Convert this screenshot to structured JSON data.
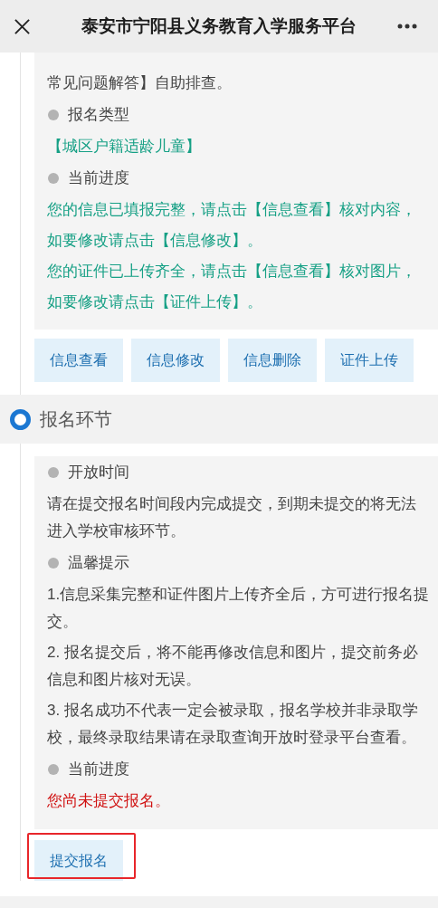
{
  "header": {
    "title": "泰安市宁阳县义务教育入学服务平台"
  },
  "sections": [
    {
      "items": [
        {
          "kind": "text",
          "text": "常见问题解答】自助排查。"
        },
        {
          "kind": "label",
          "text": "报名类型"
        },
        {
          "kind": "success",
          "text": "【城区户籍适龄儿童】"
        },
        {
          "kind": "label",
          "text": "当前进度"
        },
        {
          "kind": "success",
          "text": "您的信息已填报完整，请点击【信息查看】核对内容，"
        },
        {
          "kind": "success",
          "text": "如要修改请点击【信息修改】。"
        },
        {
          "kind": "success",
          "text": "您的证件已上传齐全，请点击【信息查看】核对图片，"
        },
        {
          "kind": "success",
          "text": "如要修改请点击【证件上传】。"
        }
      ],
      "buttons": [
        {
          "label": "信息查看",
          "highlighted": false
        },
        {
          "label": "信息修改",
          "highlighted": false
        },
        {
          "label": "信息删除",
          "highlighted": false
        },
        {
          "label": "证件上传",
          "highlighted": false
        }
      ]
    },
    {
      "title": "报名环节",
      "items": [
        {
          "kind": "label",
          "text": "开放时间"
        },
        {
          "kind": "text",
          "text": "请在提交报名时间段内完成提交，到期未提交的将无法进入学校审核环节。"
        },
        {
          "kind": "label",
          "text": "温馨提示"
        },
        {
          "kind": "text",
          "text": "1.信息采集完整和证件图片上传齐全后，方可进行报名提交。"
        },
        {
          "kind": "text",
          "text": "2. 报名提交后，将不能再修改信息和图片，提交前务必信息和图片核对无误。"
        },
        {
          "kind": "text",
          "text": "3. 报名成功不代表一定会被录取，报名学校并非录取学校，最终录取结果请在录取查询开放时登录平台查看。"
        },
        {
          "kind": "label",
          "text": "当前进度"
        },
        {
          "kind": "error",
          "text": "您尚未提交报名。"
        }
      ],
      "buttons": [
        {
          "label": "提交报名",
          "highlighted": true
        }
      ]
    }
  ]
}
